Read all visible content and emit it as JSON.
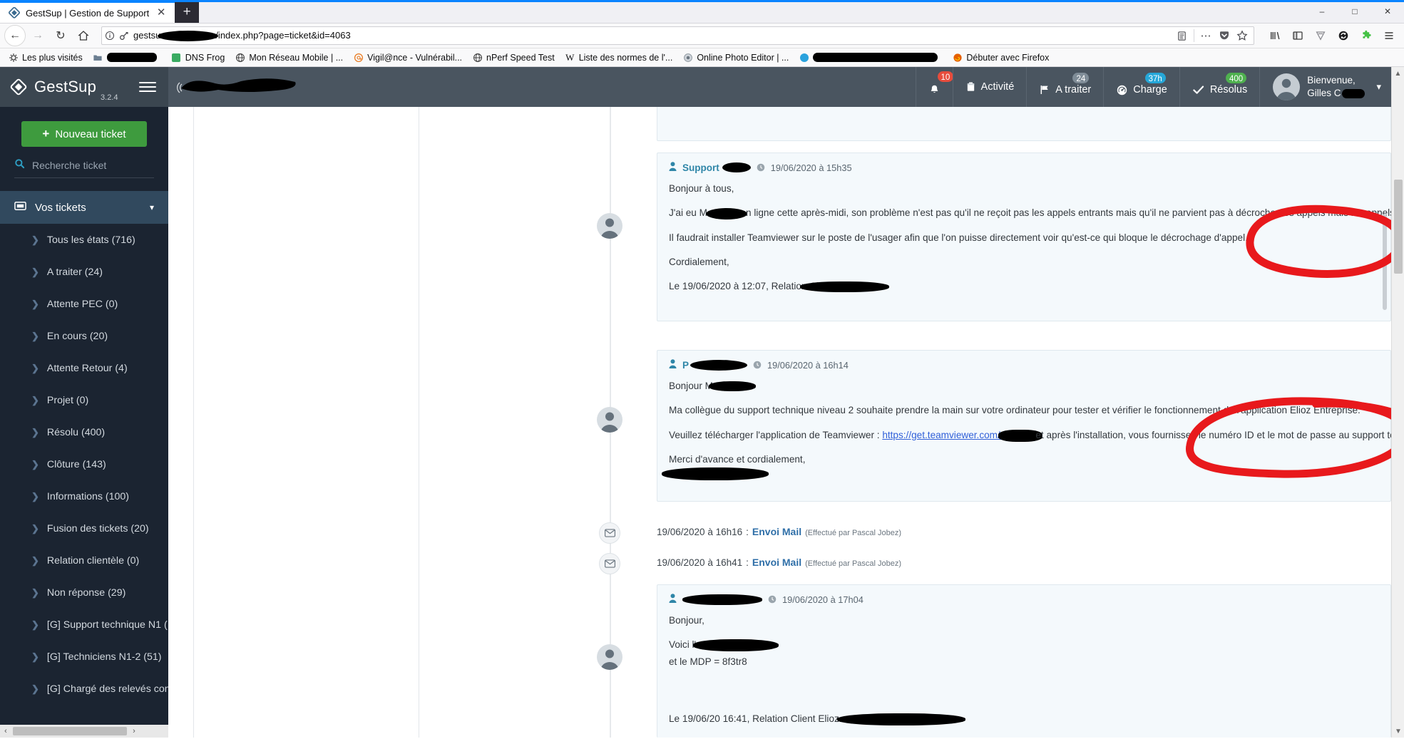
{
  "browser": {
    "tab": {
      "title": "GestSup | Gestion de Support",
      "favicon_icon": "gestsup-diamond-icon",
      "close_icon": "close-icon"
    },
    "new_tab_label": "+",
    "window_controls": {
      "minimize": "–",
      "maximize": "□",
      "close": "✕"
    },
    "nav": {
      "back_icon": "back-arrow-icon",
      "forward_icon": "forward-arrow-icon",
      "reload_icon": "reload-icon",
      "home_icon": "home-icon"
    },
    "url": {
      "info_icon": "page-info-icon",
      "key_icon": "saved-login-key-icon",
      "value_prefix": "gestsu",
      "value_suffix": "/index.php?page=ticket&id=4063",
      "reader_icon": "reader-view-icon",
      "more_icon": "page-actions-ellipsis-icon",
      "pocket_icon": "pocket-icon",
      "bookmark_icon": "bookmark-star-icon"
    },
    "toolbar_right": {
      "library_icon": "library-icon",
      "sidebar_icon": "sidebar-icon",
      "shield_icon": "tracking-protection-icon",
      "sync_icon": "sync-icon",
      "extension_icon": "puzzle-extension-icon",
      "menu_icon": "hamburger-menu-icon"
    },
    "bookmarks": [
      {
        "label": "Les plus visités",
        "icon": "star-gear-icon",
        "redacted": false
      },
      {
        "label": "",
        "icon": "folder-icon",
        "redacted": true
      },
      {
        "label": "DNS Frog",
        "icon": "green-square-icon",
        "redacted": false
      },
      {
        "label": "Mon Réseau Mobile | ...",
        "icon": "globe-icon",
        "redacted": false
      },
      {
        "label": "Vigil@nce - Vulnérabil...",
        "icon": "at-sign-icon",
        "redacted": false
      },
      {
        "label": "nPerf Speed Test",
        "icon": "globe-icon",
        "redacted": false
      },
      {
        "label": "Liste des normes de l'...",
        "icon": "wikipedia-icon",
        "redacted": false
      },
      {
        "label": "Online Photo Editor | ...",
        "icon": "camera-icon",
        "redacted": false
      },
      {
        "label": "",
        "icon": "blue-circle-icon",
        "redacted": true
      },
      {
        "label": "Débuter avec Firefox",
        "icon": "firefox-icon",
        "redacted": false
      }
    ]
  },
  "app": {
    "brand": {
      "name": "GestSup",
      "version": "3.2.4",
      "logo_icon": "gestsup-diamond-icon",
      "menu_icon": "hamburger-icon"
    },
    "header_nav": [
      {
        "label": "",
        "badge": "10",
        "badge_color": "#e74c3c",
        "icon": "bell-icon",
        "name": "notifications"
      },
      {
        "label": "Activité",
        "badge": "",
        "badge_color": "",
        "icon": "clipboard-icon",
        "name": "activite"
      },
      {
        "label": "A traiter",
        "badge": "24",
        "badge_color": "#7f8c97",
        "icon": "flag-icon",
        "name": "a-traiter"
      },
      {
        "label": "Charge",
        "badge": "37h",
        "badge_color": "#25a7d8",
        "icon": "gauge-icon",
        "name": "charge"
      },
      {
        "label": "Résolus",
        "badge": "400",
        "badge_color": "#4fb14f",
        "icon": "check-icon",
        "name": "resolus"
      }
    ],
    "user": {
      "greeting": "Bienvenue,",
      "name": "Gilles C",
      "avatar_icon": "user-avatar-icon",
      "caret_icon": "chevron-down-icon"
    },
    "sidebar": {
      "new_ticket_label": "Nouveau ticket",
      "new_ticket_icon": "plus-icon",
      "search_placeholder": "Recherche ticket",
      "search_icon": "search-icon",
      "section": {
        "label": "Vos tickets",
        "icon": "ticket-icon",
        "caret": "chevron-down-icon"
      },
      "items": [
        {
          "label": "Tous les états (716)"
        },
        {
          "label": "A traiter (24)"
        },
        {
          "label": "Attente PEC (0)"
        },
        {
          "label": "En cours (20)"
        },
        {
          "label": "Attente Retour (4)"
        },
        {
          "label": "Projet (0)"
        },
        {
          "label": "Résolu (400)"
        },
        {
          "label": "Clôture (143)"
        },
        {
          "label": "Informations (100)"
        },
        {
          "label": "Fusion des tickets (20)"
        },
        {
          "label": "Relation clientèle (0)"
        },
        {
          "label": "Non réponse (29)"
        },
        {
          "label": "[G] Support technique N1 ("
        },
        {
          "label": "[G] Techniciens N1-2 (51)"
        },
        {
          "label": "[G] Chargé des relevés con"
        }
      ],
      "scroll_left_icon": "chevron-left-icon",
      "scroll_right_icon": "chevron-right-icon"
    },
    "timeline": {
      "messages": [
        {
          "author": "Support",
          "author_redacted": true,
          "date": "19/06/2020 à 15h35",
          "clock_icon": "clock-icon",
          "user_icon": "user-icon",
          "paragraphs": [
            "Bonjour à tous,",
            "J'ai eu M[REDACTED] en ligne cette après-midi, son problème n'est pas qu'il ne reçoit pas les appels entrants mais qu'il ne parvient pas à décrocher les appels mais les appels entrants sont bien reçu.",
            "Il faudrait installer Teamviewer sur le poste de l'usager afin que l'on puisse directement voir qu'est-ce qui bloque le décrochage d'appel.",
            "Cordialement,",
            "Le 19/06/2020 à 12:07, Relation Cl"
          ]
        },
        {
          "author": "P",
          "author_redacted": true,
          "date": "19/06/2020 à 16h14",
          "clock_icon": "clock-icon",
          "user_icon": "user-icon",
          "paragraphs": [
            "Bonjour M",
            "Ma collègue du support technique niveau 2 souhaite prendre la main sur votre ordinateur pour tester et vérifier le fonctionnement de l'application Elioz Entreprise.",
            "Veuillez télécharger l'application de Teamviewer : ",
            "Merci d'avance et cordialement,"
          ],
          "link_text": "https://get.teamviewer.com/e",
          "after_link": "et après l'installation, vous fournissez le numéro ID et le mot de passe au support technique par email : support@ive"
        }
      ],
      "mail_events": [
        {
          "date": "19/06/2020 à 16h16",
          "separator": ":",
          "label": "Envoi Mail",
          "by": "(Effectué par Pascal Jobez)",
          "icon": "envelope-icon"
        },
        {
          "date": "19/06/2020 à 16h41",
          "separator": ":",
          "label": "Envoi Mail",
          "by": "(Effectué par Pascal Jobez)",
          "icon": "envelope-icon"
        }
      ],
      "last_message": {
        "author": "",
        "author_redacted": true,
        "date": "19/06/2020 à 17h04",
        "clock_icon": "clock-icon",
        "user_icon": "user-icon",
        "paragraphs": [
          "Bonjour,",
          "Voici l'",
          "et le MDP = 8f3tr8",
          "Le 19/06/20 16:41, Relation Client Elioz a"
        ]
      }
    },
    "scrollbars": {
      "up_icon": "chevron-up-icon",
      "down_icon": "chevron-down-icon"
    }
  },
  "colors": {
    "brand_dark": "#3b4650",
    "header": "#4a5560",
    "sidebar": "#1b2431",
    "sidebar_active": "#31495e",
    "green_button": "#3e9b3e",
    "accent_teal": "#2e9fc4",
    "card_bg": "#f4f9fc",
    "annotation_red": "#e8191c",
    "link_blue": "#2f6fa8"
  }
}
